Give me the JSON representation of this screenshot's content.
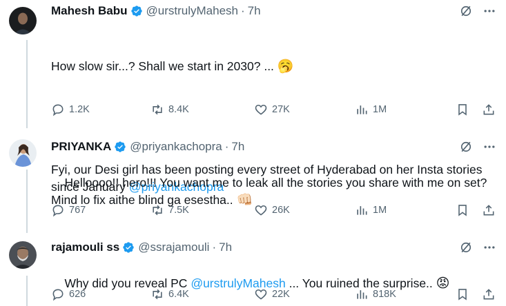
{
  "colors": {
    "accent": "#1d9bf0",
    "muted": "#536471",
    "text": "#0f1419",
    "verified": "#1d9bf0"
  },
  "tweets": [
    {
      "name": "Mahesh Babu",
      "handle": "@urstrulyMahesh",
      "dot": "·",
      "time": "7h",
      "line1": "How slow sir...? Shall we start in 2030? ... ",
      "line1_emoji": "🥱",
      "line2": "Fyi, our Desi girl has been posting every street of Hyderabad on her Insta stories since January ",
      "mention": "@priyankachopra",
      "replies": "1.2K",
      "retweets": "8.4K",
      "likes": "27K",
      "views": "1M"
    },
    {
      "name": "PRIYANKA",
      "handle": "@priyankachopra",
      "dot": "·",
      "time": "7h",
      "line1": "Helloooo!! hero!!! You want me to leak all the stories you share with me on set? Mind lo fix aithe blind ga esestha.. ",
      "line1_emoji": "👊🏻",
      "replies": "767",
      "retweets": "7.5K",
      "likes": "26K",
      "views": "1M"
    },
    {
      "name": "rajamouli ss",
      "handle": "@ssrajamouli",
      "dot": "·",
      "time": "7h",
      "line1": "Why did you reveal PC ",
      "mention": "@urstrulyMahesh",
      "line1_after": " ... You ruined the surprise.. ",
      "line1_emoji": "😡",
      "replies": "626",
      "retweets": "6.4K",
      "likes": "22K",
      "views": "818K"
    }
  ]
}
